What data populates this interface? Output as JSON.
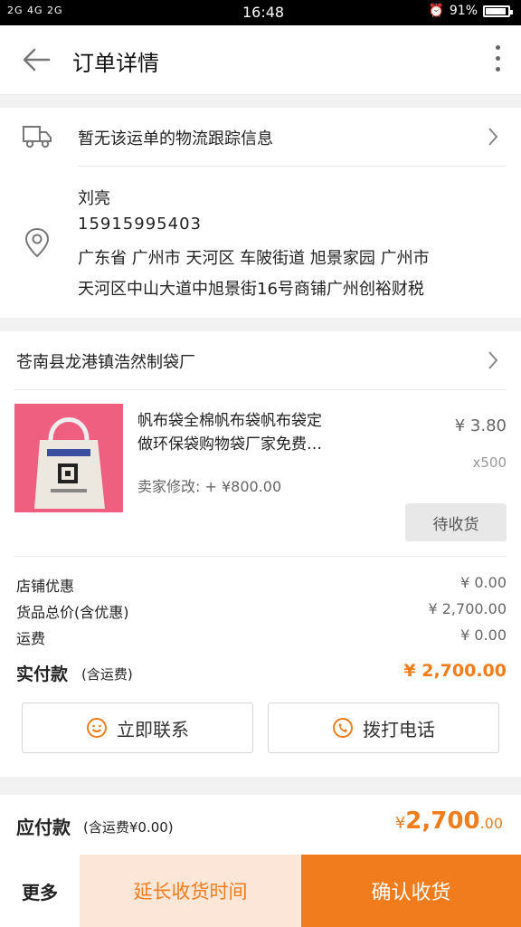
{
  "status_bar": {
    "signal_text": "2G 4G 2G",
    "time": "16:48",
    "battery": "91%"
  },
  "header": {
    "title": "订单详情"
  },
  "logistics": {
    "text": "暂无该运单的物流跟踪信息"
  },
  "address": {
    "name": "刘亮",
    "phone": "15915995403",
    "line1": "广东省 广州市 天河区 车陂街道 旭景家园 广州市",
    "line2": "天河区中山大道中旭景街16号商铺广州创裕财税"
  },
  "shop": {
    "name": "苍南县龙港镇浩然制袋厂"
  },
  "product": {
    "title_line1": "帆布袋全棉帆布袋帆布袋定",
    "title_line2": "做环保袋购物袋厂家免费…",
    "price": "¥ 3.80",
    "quantity": "x500",
    "seller_adjust": "卖家修改: + ¥800.00",
    "status_button": "待收货"
  },
  "summary": {
    "items": [
      {
        "label": "店铺优惠",
        "value": "¥ 0.00"
      },
      {
        "label": "货品总价(含优惠)",
        "value": "¥ 2,700.00"
      },
      {
        "label": "运费",
        "value": "¥ 0.00"
      }
    ],
    "paid_label": "实付款",
    "paid_note": "(含运费)",
    "paid_value": "¥ 2,700.00"
  },
  "contact": {
    "contact_label": "立即联系",
    "call_label": "拨打电话"
  },
  "payable": {
    "label": "应付款",
    "note": "(含运费¥0.00)",
    "currency": "¥",
    "amount": "2,700",
    "cents": ".00"
  },
  "bottom_bar": {
    "more": "更多",
    "extend": "延长收货时间",
    "confirm": "确认收货"
  },
  "colors": {
    "accent": "#f07c1c",
    "accent_light": "#fce6d8"
  }
}
